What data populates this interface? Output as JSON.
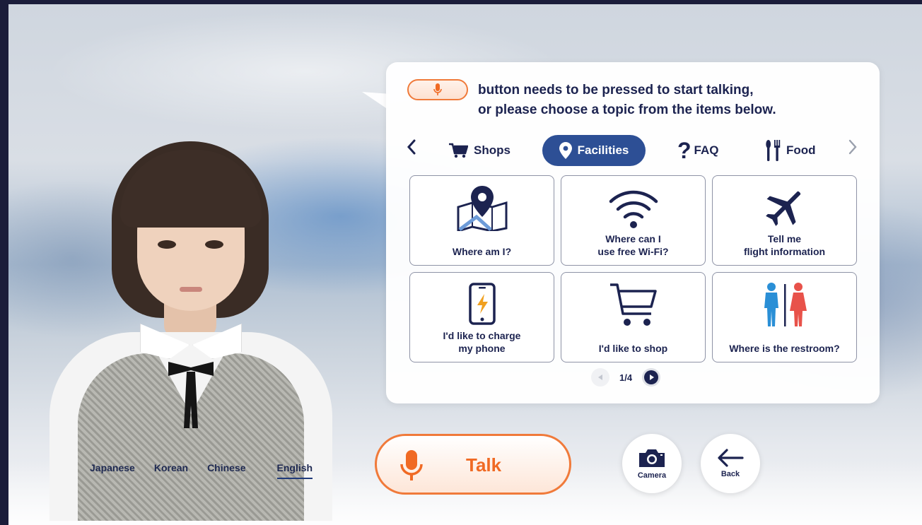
{
  "prompt": {
    "line1": "button needs to be pressed to start talking,",
    "line2": "or please choose a topic from the items below."
  },
  "tabs": [
    {
      "label": "Shops",
      "icon": "cart-icon",
      "active": false
    },
    {
      "label": "Facilities",
      "icon": "location-pin-icon",
      "active": true
    },
    {
      "label": "FAQ",
      "icon": "question-icon",
      "active": false
    },
    {
      "label": "Food",
      "icon": "fork-knife-icon",
      "active": false
    }
  ],
  "cards": [
    {
      "label": "Where am I?",
      "icon": "map-pin-icon"
    },
    {
      "label": "Where can I\nuse free Wi-Fi?",
      "icon": "wifi-icon"
    },
    {
      "label": "Tell me\nflight information",
      "icon": "airplane-icon"
    },
    {
      "label": "I'd like to charge\nmy phone",
      "icon": "phone-charge-icon"
    },
    {
      "label": "I'd like to shop",
      "icon": "shopping-cart-icon"
    },
    {
      "label": "Where is the restroom?",
      "icon": "restroom-icon"
    }
  ],
  "pager": {
    "text": "1/4"
  },
  "talk": {
    "label": "Talk"
  },
  "camera": {
    "label": "Camera"
  },
  "back": {
    "label": "Back"
  },
  "languages": [
    {
      "label": "Japanese",
      "active": false
    },
    {
      "label": "Korean",
      "active": false
    },
    {
      "label": "Chinese",
      "active": false
    },
    {
      "label": "English",
      "active": true
    }
  ],
  "colors": {
    "accent_orange": "#f07a3a",
    "navy": "#1c2350",
    "active_tab": "#2d4f95",
    "restroom_male": "#2a8fd6",
    "restroom_female": "#e8524a"
  }
}
